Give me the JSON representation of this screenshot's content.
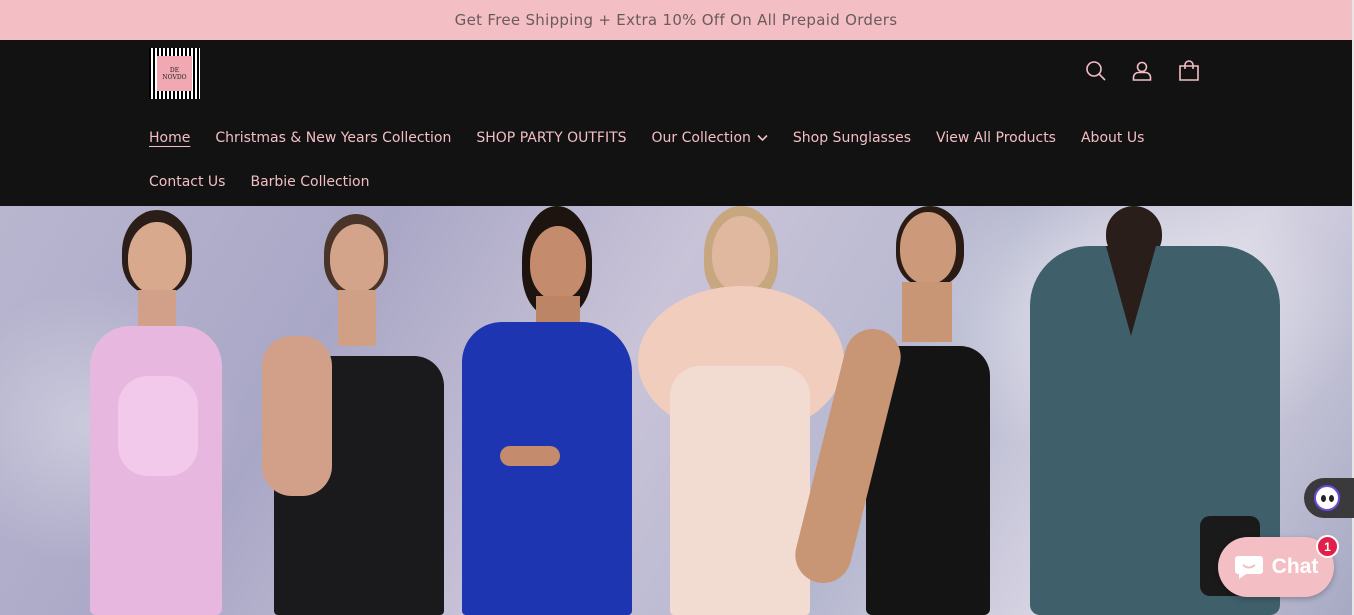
{
  "announcement": {
    "text": "Get Free Shipping + Extra 10% Off On All Prepaid Orders"
  },
  "brand": {
    "logo_line1": "DE",
    "logo_line2": "NOVDO"
  },
  "header_icons": [
    "search-icon",
    "account-icon",
    "cart-icon"
  ],
  "nav": {
    "row1": [
      {
        "label": "Home",
        "active": true
      },
      {
        "label": "Christmas & New Years Collection"
      },
      {
        "label": "SHOP PARTY OUTFITS"
      },
      {
        "label": "Our Collection",
        "dropdown": true
      },
      {
        "label": "Shop Sunglasses"
      },
      {
        "label": "View All Products"
      },
      {
        "label": "About Us"
      }
    ],
    "row2": [
      {
        "label": "Contact Us"
      },
      {
        "label": "Barbie Collection"
      }
    ]
  },
  "chat": {
    "label": "Chat",
    "badge": "1"
  },
  "colors": {
    "accent": "#f3bfc4",
    "header_bg": "#121212",
    "badge": "#e0204a"
  }
}
